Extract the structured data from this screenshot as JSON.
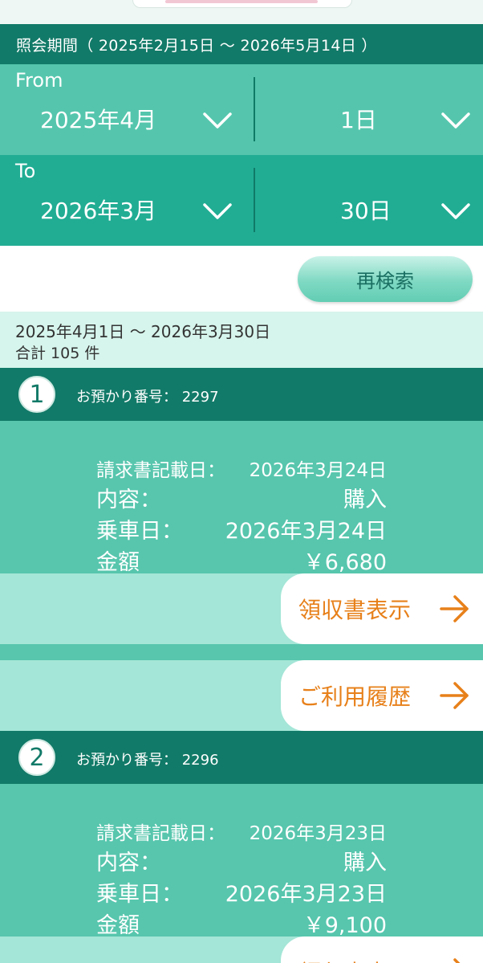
{
  "period_header": "照会期間（ 2025年2月15日 〜 2026年5月14日 ）",
  "from": {
    "label": "From",
    "month": "2025年4月",
    "day": "1日"
  },
  "to": {
    "label": "To",
    "month": "2026年3月",
    "day": "30日"
  },
  "research_button": "再検索",
  "summary": {
    "range": "2025年4月1日 〜 2026年3月30日",
    "count": "合計 105 件"
  },
  "entries": [
    {
      "number": "1",
      "account_label": "お預かり番号：",
      "account_number": "2297",
      "invoice_date_label": "請求書記載日：",
      "invoice_date": "2026年3月24日",
      "content_label": "内容：",
      "content": "購入",
      "ride_date_label": "乗車日：",
      "ride_date": "2026年3月24日",
      "amount_label": "金額",
      "amount": "￥6,680",
      "receipt_button": "領収書表示",
      "history_button": "ご利用履歴"
    },
    {
      "number": "2",
      "account_label": "お預かり番号：",
      "account_number": "2296",
      "invoice_date_label": "請求書記載日：",
      "invoice_date": "2026年3月23日",
      "content_label": "内容：",
      "content": "購入",
      "ride_date_label": "乗車日：",
      "ride_date": "2026年3月23日",
      "amount_label": "金額",
      "amount": "￥9,100",
      "receipt_button": "領収書表示"
    }
  ],
  "colors": {
    "header_dark": "#127a68",
    "from_row": "#55c6ad",
    "to_row": "#21ad94",
    "summary_bg": "#d6f5ec",
    "action_accent": "#e7801a"
  }
}
